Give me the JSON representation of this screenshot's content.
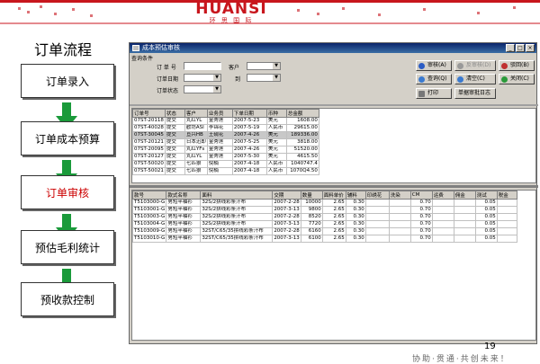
{
  "header": {
    "logo_text": "HUANSI",
    "logo_sub": "环 思 国 际"
  },
  "flow": {
    "title": "订单流程",
    "steps": [
      {
        "label": "订单录入"
      },
      {
        "label": "订单成本预算"
      },
      {
        "label": "订单审核"
      },
      {
        "label": "预估毛利统计"
      },
      {
        "label": "预收款控制"
      }
    ]
  },
  "window": {
    "title": "成本预估审核",
    "query_section": "查询条件",
    "labels": {
      "order_no": "订 单 号",
      "order_date": "订单日期",
      "order_status": "订单状态",
      "customer": "客户",
      "to": "到"
    },
    "buttons": {
      "approve": "审核(A)",
      "unapprove": "反审核(D)",
      "back": "驳回(B)",
      "query": "查询(Q)",
      "clear": "清空(C)",
      "close": "关闭(C)",
      "print": "打印",
      "log": "单据审批日志"
    },
    "orders_grid": {
      "columns": [
        "订单号",
        "状态",
        "客户",
        "业务员",
        "下单日期",
        "币种",
        "总金额"
      ],
      "rows": [
        [
          "07ST-20118",
          "提交",
          "丸红YL",
          "金秀莲",
          "2007-5-23",
          "美元",
          "1608.00"
        ],
        [
          "07ST-40028",
          "提交",
          "歡坊ASI",
          "李锦花",
          "2007-5-19",
          "人民币",
          "29615.00"
        ],
        [
          "07ST-30045",
          "提交",
          "亘兴HB",
          "王砚花",
          "2007-4-26",
          "美元",
          "189336.00"
        ],
        [
          "07ST-20121",
          "提交",
          "日本迅即",
          "金秀莲",
          "2007-5-25",
          "美元",
          "3818.00"
        ],
        [
          "07ST-20095",
          "提交",
          "丸红YFs",
          "金秀莲",
          "2007-4-26",
          "美元",
          "51520.00"
        ],
        [
          "07ST-20127",
          "提交",
          "丸红YL",
          "金秀莲",
          "2007-5-30",
          "美元",
          "4615.50"
        ],
        [
          "07ST-50020",
          "提交",
          "七匹狼",
          "倪楠",
          "2007-4-18",
          "人民币",
          "1040747.4"
        ],
        [
          "07ST-50021",
          "提交",
          "七匹狼",
          "倪楠",
          "2007-4-18",
          "人民币",
          "1070Q4.50"
        ]
      ]
    },
    "detail_grid": {
      "columns": [
        "款号",
        "款式名称",
        "面料",
        "交期",
        "数量",
        "面料单价",
        "辅料",
        "印绣花",
        "洗染",
        "CM",
        "运费",
        "佣金",
        "测试",
        "税金"
      ],
      "rows": [
        [
          "T5103000-G",
          "男短半袖衫",
          "32S/2拼线彩条汗布",
          "2007-2-28",
          "10000",
          "2.65",
          "0.30",
          "",
          "",
          "0.70",
          "",
          "",
          "0.05",
          ""
        ],
        [
          "T5103001-G",
          "男短半袖衫",
          "32S/2拼线彩条汗布",
          "2007-3-13",
          "9800",
          "2.65",
          "0.30",
          "",
          "",
          "0.70",
          "",
          "",
          "0.05",
          ""
        ],
        [
          "T5103003-G",
          "男短半袖衫",
          "32S/2拼线彩条汗布",
          "2007-2-28",
          "8520",
          "2.65",
          "0.30",
          "",
          "",
          "0.70",
          "",
          "",
          "0.05",
          ""
        ],
        [
          "T5103004-G",
          "男短半袖衫",
          "32S/2拼线彩条汗布",
          "2007-3-13",
          "7720",
          "2.65",
          "0.30",
          "",
          "",
          "0.70",
          "",
          "",
          "0.05",
          ""
        ],
        [
          "T5103009-G",
          "男短半袖衫",
          "32ST/C65/35拼线彩条汗布",
          "2007-2-28",
          "6160",
          "2.65",
          "0.30",
          "",
          "",
          "0.70",
          "",
          "",
          "0.05",
          ""
        ],
        [
          "T5103010-G",
          "男短半袖衫",
          "32ST/C65/35拼线彩条汗布",
          "2007-3-13",
          "6100",
          "2.65",
          "0.30",
          "",
          "",
          "0.70",
          "",
          "",
          "0.05",
          ""
        ]
      ]
    }
  },
  "page_number": "19",
  "slogan": "协助·贯通·共创未来！",
  "colors": {
    "brand_red": "#c8161d",
    "arrow_green": "#1a9a3a",
    "title_blue": "#0a246a"
  }
}
